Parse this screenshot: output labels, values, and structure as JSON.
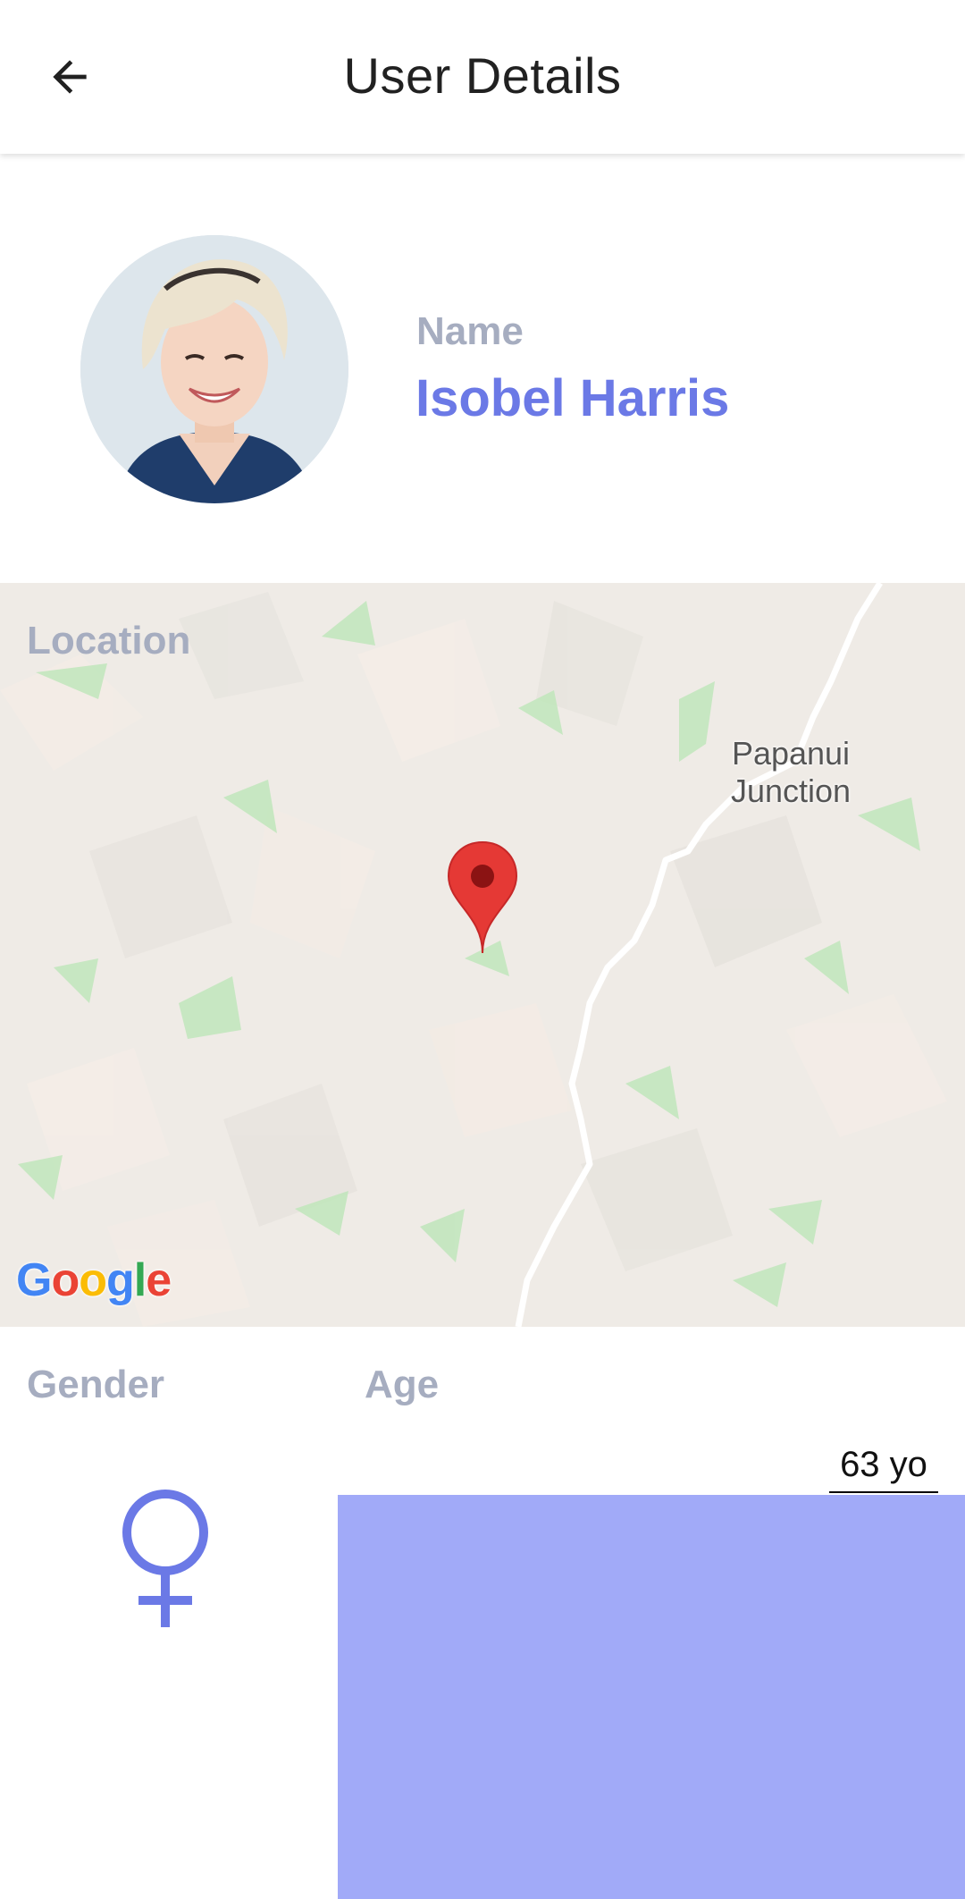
{
  "header": {
    "title": "User Details",
    "back_icon": "arrow-left-icon"
  },
  "profile": {
    "name_label": "Name",
    "name_value": "Isobel Harris",
    "avatar_icon": "avatar-photo"
  },
  "location": {
    "label": "Location",
    "place_label": "Papanui Junction",
    "pin_icon": "map-pin-icon",
    "attribution": "Google"
  },
  "details": {
    "gender_label": "Gender",
    "gender_icon": "female-symbol-icon",
    "age_label": "Age",
    "age_value": "63 yo"
  },
  "colors": {
    "accent": "#6b79e6",
    "label_gray": "#a6adc0",
    "age_bar": "#a1aaf8",
    "pin_red": "#e53935"
  }
}
